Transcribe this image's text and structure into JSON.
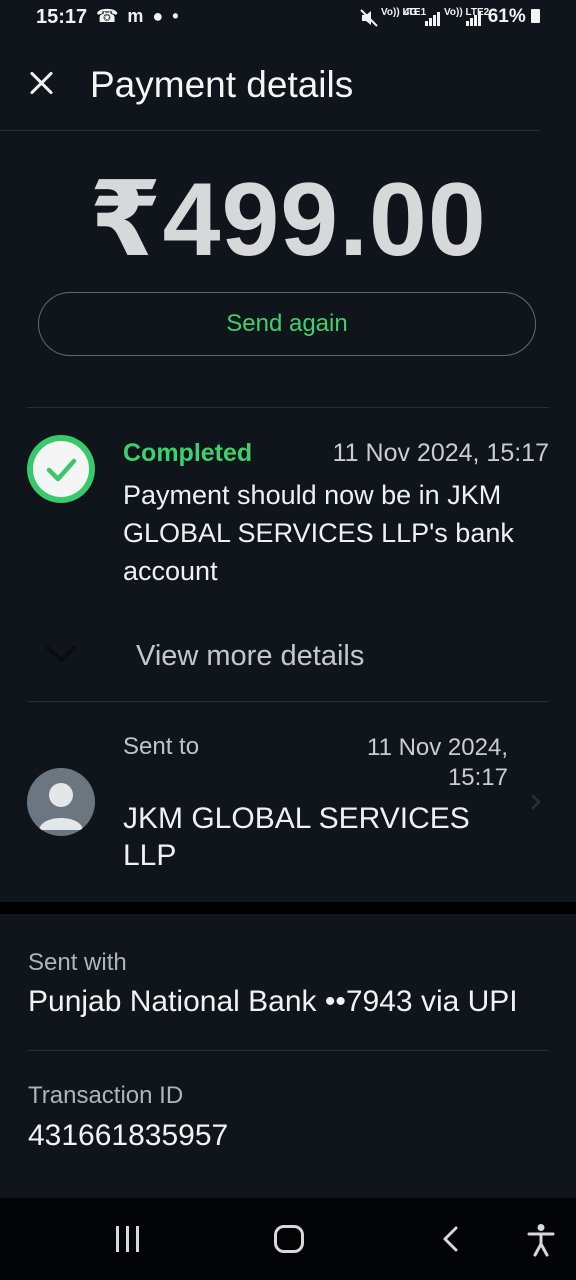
{
  "status_bar": {
    "time": "15:17",
    "left_icons": "☎ m ● •",
    "sim1_label": "Vo)) LTE1",
    "sim2_label": "Vo)) LTE2",
    "network": "4G",
    "battery": "61%"
  },
  "header": {
    "title": "Payment details",
    "close_icon": "close-icon"
  },
  "payment": {
    "amount": "₹499.00",
    "send_again_label": "Send again"
  },
  "status": {
    "label": "Completed",
    "timestamp": "11 Nov 2024, 15:17",
    "message": "Payment should now be in JKM GLOBAL SERVICES LLP's bank account",
    "color": "#3fcf6b"
  },
  "view_more": {
    "label": "View more details"
  },
  "recipient": {
    "sent_to_label": "Sent to",
    "timestamp": "11 Nov 2024, 15:17",
    "name": "JKM GLOBAL SERVICES LLP"
  },
  "sent_with": {
    "label": "Sent with",
    "value": "Punjab National Bank ••7943 via UPI"
  },
  "transaction": {
    "label": "Transaction ID",
    "value": "431661835957"
  },
  "colors": {
    "background": "#0f151b",
    "accent_green": "#3fcf6b"
  }
}
